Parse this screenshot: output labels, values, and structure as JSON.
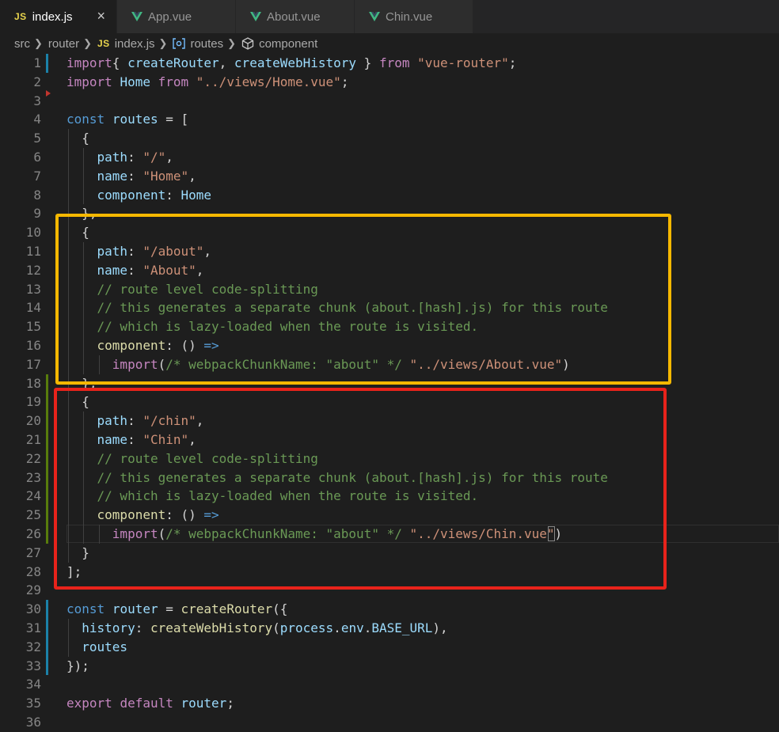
{
  "tabs": [
    {
      "label": "index.js",
      "icon": "js-icon",
      "icon_text": "JS",
      "active": true
    },
    {
      "label": "App.vue",
      "icon": "vue-icon",
      "icon_text": "",
      "active": false
    },
    {
      "label": "About.vue",
      "icon": "vue-icon",
      "icon_text": "",
      "active": false
    },
    {
      "label": "Chin.vue",
      "icon": "vue-icon",
      "icon_text": "",
      "active": false
    }
  ],
  "close_glyph": "×",
  "breadcrumb": {
    "items": [
      "src",
      "router",
      "index.js",
      "routes",
      "component"
    ],
    "js_icon_text": "JS"
  },
  "colors": {
    "accent_yellow": "#f5b800",
    "accent_red": "#e8231b",
    "gutter_modified": "#1b81a8",
    "gutter_added": "#587c0c",
    "vue_green": "#41b883"
  },
  "code_lines": [
    {
      "n": "1",
      "tokens": [
        [
          "kw2",
          "import"
        ],
        [
          "",
          "{ "
        ],
        [
          "prop",
          "createRouter"
        ],
        [
          "",
          ", "
        ],
        [
          "prop",
          "createWebHistory"
        ],
        [
          "",
          " } "
        ],
        [
          "kw2",
          "from"
        ],
        [
          "",
          " "
        ],
        [
          "str",
          "\"vue-router\""
        ],
        [
          "",
          ";"
        ]
      ]
    },
    {
      "n": "2",
      "tokens": [
        [
          "kw2",
          "import"
        ],
        [
          "",
          " "
        ],
        [
          "prop",
          "Home"
        ],
        [
          "",
          " "
        ],
        [
          "kw2",
          "from"
        ],
        [
          "",
          " "
        ],
        [
          "str",
          "\"../views/Home.vue\""
        ],
        [
          "",
          ";"
        ]
      ]
    },
    {
      "n": "3",
      "tokens": []
    },
    {
      "n": "4",
      "tokens": [
        [
          "kw",
          "const"
        ],
        [
          "",
          " "
        ],
        [
          "prop",
          "routes"
        ],
        [
          "",
          " = ["
        ]
      ]
    },
    {
      "n": "5",
      "tokens": [
        [
          "",
          "  {"
        ]
      ]
    },
    {
      "n": "6",
      "tokens": [
        [
          "",
          "    "
        ],
        [
          "prop",
          "path"
        ],
        [
          "",
          ": "
        ],
        [
          "str",
          "\"/\""
        ],
        [
          "",
          ","
        ]
      ]
    },
    {
      "n": "7",
      "tokens": [
        [
          "",
          "    "
        ],
        [
          "prop",
          "name"
        ],
        [
          "",
          ": "
        ],
        [
          "str",
          "\"Home\""
        ],
        [
          "",
          ","
        ]
      ]
    },
    {
      "n": "8",
      "tokens": [
        [
          "",
          "    "
        ],
        [
          "prop",
          "component"
        ],
        [
          "",
          ": "
        ],
        [
          "prop",
          "Home"
        ]
      ]
    },
    {
      "n": "9",
      "tokens": [
        [
          "",
          "  },"
        ]
      ]
    },
    {
      "n": "10",
      "tokens": [
        [
          "",
          "  {"
        ]
      ]
    },
    {
      "n": "11",
      "tokens": [
        [
          "",
          "    "
        ],
        [
          "prop",
          "path"
        ],
        [
          "",
          ": "
        ],
        [
          "str",
          "\"/about\""
        ],
        [
          "",
          ","
        ]
      ]
    },
    {
      "n": "12",
      "tokens": [
        [
          "",
          "    "
        ],
        [
          "prop",
          "name"
        ],
        [
          "",
          ": "
        ],
        [
          "str",
          "\"About\""
        ],
        [
          "",
          ","
        ]
      ]
    },
    {
      "n": "13",
      "tokens": [
        [
          "",
          "    "
        ],
        [
          "com",
          "// route level code-splitting"
        ]
      ]
    },
    {
      "n": "14",
      "tokens": [
        [
          "",
          "    "
        ],
        [
          "com",
          "// this generates a separate chunk (about.[hash].js) for this route"
        ]
      ]
    },
    {
      "n": "15",
      "tokens": [
        [
          "",
          "    "
        ],
        [
          "com",
          "// which is lazy-loaded when the route is visited."
        ]
      ]
    },
    {
      "n": "16",
      "tokens": [
        [
          "",
          "    "
        ],
        [
          "fn",
          "component"
        ],
        [
          "",
          ": () "
        ],
        [
          "kw",
          "=>"
        ]
      ]
    },
    {
      "n": "17",
      "tokens": [
        [
          "",
          "      "
        ],
        [
          "kw2",
          "import"
        ],
        [
          "",
          "("
        ],
        [
          "com",
          "/* webpackChunkName: \"about\" */"
        ],
        [
          "",
          " "
        ],
        [
          "str",
          "\"../views/About.vue\""
        ],
        [
          "",
          ")"
        ]
      ]
    },
    {
      "n": "18",
      "tokens": [
        [
          "",
          "  },"
        ]
      ]
    },
    {
      "n": "19",
      "tokens": [
        [
          "",
          "  {"
        ]
      ]
    },
    {
      "n": "20",
      "tokens": [
        [
          "",
          "    "
        ],
        [
          "prop",
          "path"
        ],
        [
          "",
          ": "
        ],
        [
          "str",
          "\"/chin\""
        ],
        [
          "",
          ","
        ]
      ]
    },
    {
      "n": "21",
      "tokens": [
        [
          "",
          "    "
        ],
        [
          "prop",
          "name"
        ],
        [
          "",
          ": "
        ],
        [
          "str",
          "\"Chin\""
        ],
        [
          "",
          ","
        ]
      ]
    },
    {
      "n": "22",
      "tokens": [
        [
          "",
          "    "
        ],
        [
          "com",
          "// route level code-splitting"
        ]
      ]
    },
    {
      "n": "23",
      "tokens": [
        [
          "",
          "    "
        ],
        [
          "com",
          "// this generates a separate chunk (about.[hash].js) for this route"
        ]
      ]
    },
    {
      "n": "24",
      "tokens": [
        [
          "",
          "    "
        ],
        [
          "com",
          "// which is lazy-loaded when the route is visited."
        ]
      ]
    },
    {
      "n": "25",
      "tokens": [
        [
          "",
          "    "
        ],
        [
          "fn",
          "component"
        ],
        [
          "",
          ": () "
        ],
        [
          "kw",
          "=>"
        ]
      ]
    },
    {
      "n": "26",
      "tokens": [
        [
          "",
          "      "
        ],
        [
          "kw2",
          "import"
        ],
        [
          "",
          "("
        ],
        [
          "com",
          "/* webpackChunkName: \"about\" */"
        ],
        [
          "",
          " "
        ],
        [
          "str",
          "\"../views/Chin.vue\""
        ],
        [
          "",
          ")"
        ]
      ]
    },
    {
      "n": "27",
      "tokens": [
        [
          "",
          "  }"
        ]
      ]
    },
    {
      "n": "28",
      "tokens": [
        [
          "",
          "];"
        ]
      ]
    },
    {
      "n": "29",
      "tokens": []
    },
    {
      "n": "30",
      "tokens": [
        [
          "kw",
          "const"
        ],
        [
          "",
          " "
        ],
        [
          "prop",
          "router"
        ],
        [
          "",
          " = "
        ],
        [
          "fn",
          "createRouter"
        ],
        [
          "",
          "({"
        ]
      ]
    },
    {
      "n": "31",
      "tokens": [
        [
          "",
          "  "
        ],
        [
          "prop",
          "history"
        ],
        [
          "",
          ": "
        ],
        [
          "fn",
          "createWebHistory"
        ],
        [
          "",
          "("
        ],
        [
          "prop",
          "process"
        ],
        [
          "",
          "."
        ],
        [
          "prop",
          "env"
        ],
        [
          "",
          "."
        ],
        [
          "prop",
          "BASE_URL"
        ],
        [
          "",
          "),"
        ]
      ]
    },
    {
      "n": "32",
      "tokens": [
        [
          "",
          "  "
        ],
        [
          "prop",
          "routes"
        ]
      ]
    },
    {
      "n": "33",
      "tokens": [
        [
          "",
          "});"
        ]
      ]
    },
    {
      "n": "34",
      "tokens": []
    },
    {
      "n": "35",
      "tokens": [
        [
          "kw2",
          "export"
        ],
        [
          "",
          " "
        ],
        [
          "kw2",
          "default"
        ],
        [
          "",
          " "
        ],
        [
          "prop",
          "router"
        ],
        [
          "",
          ";"
        ]
      ]
    },
    {
      "n": "36",
      "tokens": []
    }
  ]
}
